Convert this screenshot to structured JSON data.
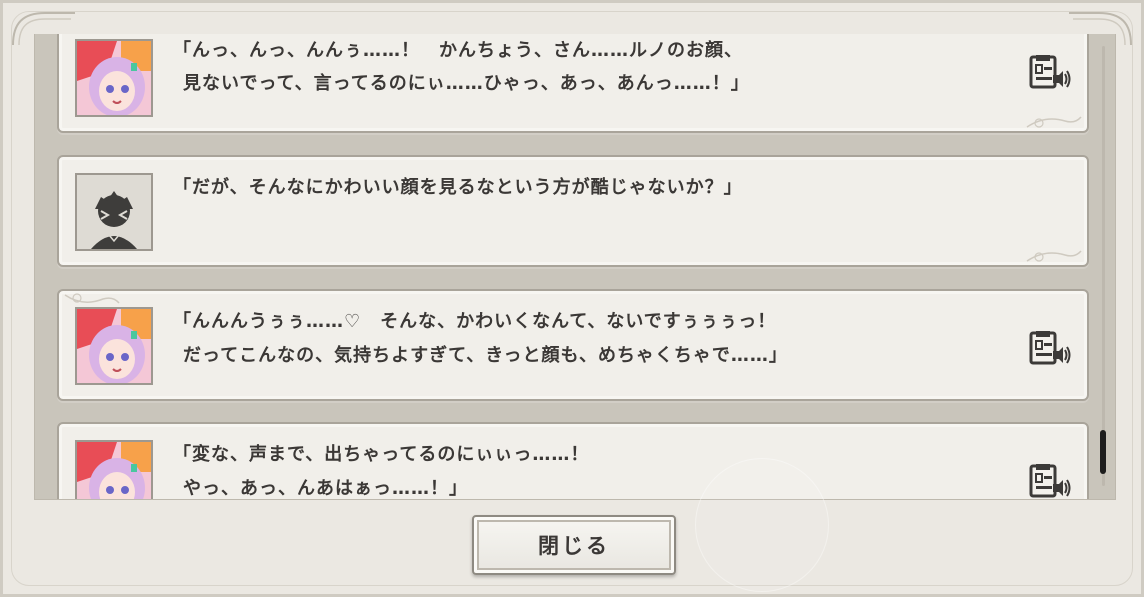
{
  "app": {
    "accent_color": "#3b3836",
    "panel_color": "#f1efea"
  },
  "log": {
    "entries": [
      {
        "speaker_avatar": "pink-hair-girl-avatar",
        "line1": "「んっ、んっ、んんぅ……！　かんちょう、さん……ルノのお顔、",
        "line2": "見ないでって、言ってるのにぃ……ひゃっ、あっ、あんっ……！」",
        "has_voice": true
      },
      {
        "speaker_avatar": "protagonist-silhouette-avatar",
        "line1": "「だが、そんなにかわいい顔を見るなという方が酷じゃないか？」",
        "line2": "",
        "has_voice": false
      },
      {
        "speaker_avatar": "pink-hair-girl-avatar",
        "line1": "「んんんうぅぅ……♡　そんな、かわいくなんて、ないですぅぅぅっ！",
        "line2": "だってこんなの、気持ちよすぎて、きっと顔も、めちゃくちゃで……」",
        "has_voice": true
      },
      {
        "speaker_avatar": "pink-hair-girl-avatar",
        "line1": "「変な、声まで、出ちゃってるのにぃぃっ……！",
        "line2": "やっ、あっ、んあはぁっ……！」",
        "has_voice": true
      }
    ]
  },
  "footer": {
    "close_label": "閉じる"
  }
}
